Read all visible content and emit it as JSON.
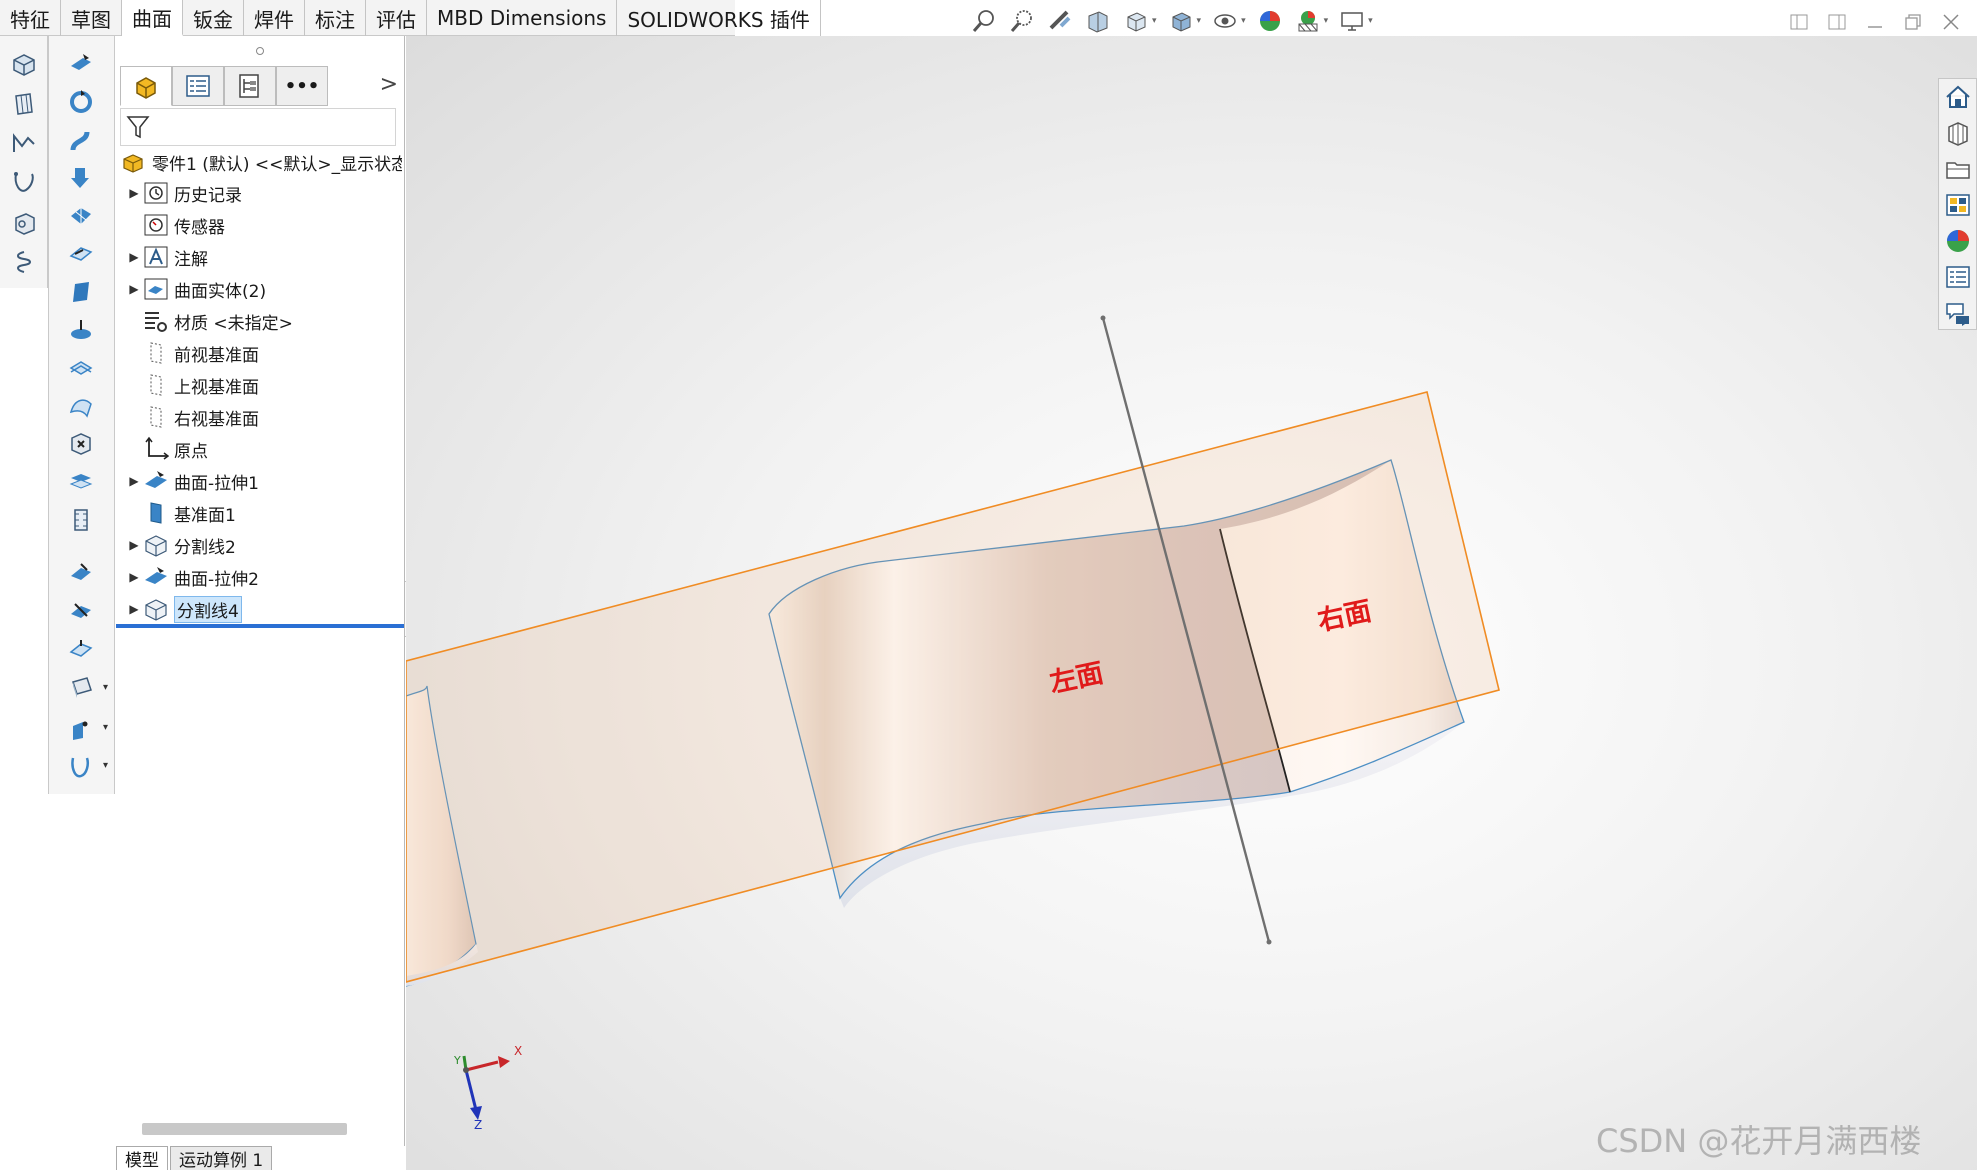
{
  "command_tabs": [
    "特征",
    "草图",
    "曲面",
    "钣金",
    "焊件",
    "标注",
    "评估",
    "MBD Dimensions",
    "SOLIDWORKS 插件"
  ],
  "active_tab_index": 2,
  "left_strip_1_icons": [
    "extrude-surface-icon",
    "planar-surface-icon",
    "sketch-icon",
    "curve-icon",
    "part-icon",
    "helix-icon"
  ],
  "left_strip_2_icons": [
    "extruded-surface-icon",
    "revolved-surface-icon",
    "swept-surface-icon",
    "lofted-surface-icon",
    "boundary-surface-icon",
    "offset-surface-icon",
    "ruled-surface-icon",
    "planar-surface-icon",
    "fill-surface-icon",
    "freeform-icon",
    "delete-face-icon",
    "replace-face-icon",
    "knit-surface-icon",
    "thicken-icon",
    "cut-with-surface-icon",
    "extend-surface-icon",
    "trim-surface-icon",
    "untrim-surface-icon",
    "reference-geometry-icon",
    "curves-icon"
  ],
  "feature_tree": {
    "panel_tabs": [
      "feature-manager-icon",
      "property-manager-icon",
      "configuration-manager-icon",
      "more-icon"
    ],
    "root_label": "零件1 (默认) <<默认>_显示状态",
    "items": [
      {
        "label": "历史记录",
        "icon": "history-icon",
        "expandable": true
      },
      {
        "label": "传感器",
        "icon": "sensor-icon",
        "expandable": false
      },
      {
        "label": "注解",
        "icon": "annotation-icon",
        "expandable": true
      },
      {
        "label": "曲面实体(2)",
        "icon": "surface-bodies-icon",
        "expandable": true
      },
      {
        "label": "材质 <未指定>",
        "icon": "material-icon",
        "expandable": false
      },
      {
        "label": "前视基准面",
        "icon": "plane-icon",
        "expandable": false
      },
      {
        "label": "上视基准面",
        "icon": "plane-icon",
        "expandable": false
      },
      {
        "label": "右视基准面",
        "icon": "plane-icon",
        "expandable": false
      },
      {
        "label": "原点",
        "icon": "origin-icon",
        "expandable": false
      },
      {
        "label": "曲面-拉伸1",
        "icon": "extruded-surface-icon",
        "expandable": true
      },
      {
        "label": "基准面1",
        "icon": "plane-icon",
        "expandable": false
      },
      {
        "label": "分割线2",
        "icon": "split-line-icon",
        "expandable": true
      },
      {
        "label": "曲面-拉伸2",
        "icon": "extruded-surface-icon",
        "expandable": true
      },
      {
        "label": "分割线4",
        "icon": "split-line-icon",
        "expandable": true,
        "selected": true
      }
    ]
  },
  "bottom_tabs": [
    "模型",
    "运动算例 1"
  ],
  "viewport": {
    "face_labels": {
      "left": "左面",
      "right": "右面"
    },
    "triad": {
      "x": "X",
      "y": "Y",
      "z": "Z"
    },
    "hud_icons": [
      "zoom-to-fit-icon",
      "zoom-to-area-icon",
      "previous-view-icon",
      "section-view-icon",
      "view-orientation-icon",
      "display-style-icon",
      "hide-show-items-icon",
      "edit-appearance-icon",
      "apply-scene-icon",
      "view-settings-icon"
    ],
    "plane_color": "#f08c24",
    "surface_edge_color": "#4d8fc4"
  },
  "task_pane_icons": [
    "home-icon",
    "design-library-icon",
    "file-explorer-icon",
    "view-palette-icon",
    "appearances-icon",
    "custom-properties-icon",
    "forum-icon"
  ],
  "watermark": "CSDN @花开月满西楼"
}
